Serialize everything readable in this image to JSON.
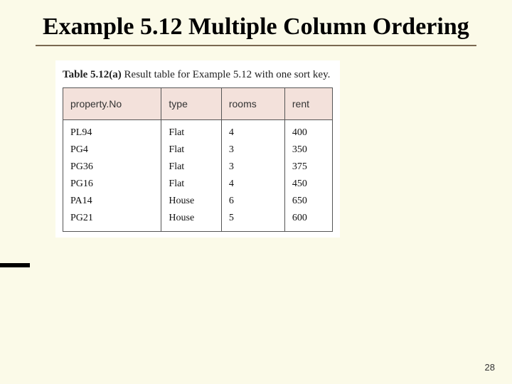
{
  "title": "Example 5.12  Multiple Column Ordering",
  "caption_bold": "Table 5.12(a)",
  "caption_rest": "   Result table for Example 5.12 with one sort key.",
  "headers": {
    "c0": "property.No",
    "c1": "type",
    "c2": "rooms",
    "c3": "rent"
  },
  "rows": [
    {
      "c0": "PL94",
      "c1": "Flat",
      "c2": "4",
      "c3": "400"
    },
    {
      "c0": "PG4",
      "c1": "Flat",
      "c2": "3",
      "c3": "350"
    },
    {
      "c0": "PG36",
      "c1": "Flat",
      "c2": "3",
      "c3": "375"
    },
    {
      "c0": "PG16",
      "c1": "Flat",
      "c2": "4",
      "c3": "450"
    },
    {
      "c0": "PA14",
      "c1": "House",
      "c2": "6",
      "c3": "650"
    },
    {
      "c0": "PG21",
      "c1": "House",
      "c2": "5",
      "c3": "600"
    }
  ],
  "page_number": "28",
  "chart_data": {
    "type": "table",
    "title": "Table 5.12(a) Result table for Example 5.12 with one sort key.",
    "columns": [
      "property.No",
      "type",
      "rooms",
      "rent"
    ],
    "rows": [
      [
        "PL94",
        "Flat",
        4,
        400
      ],
      [
        "PG4",
        "Flat",
        3,
        350
      ],
      [
        "PG36",
        "Flat",
        3,
        375
      ],
      [
        "PG16",
        "Flat",
        4,
        450
      ],
      [
        "PA14",
        "House",
        6,
        650
      ],
      [
        "PG21",
        "House",
        5,
        600
      ]
    ]
  }
}
